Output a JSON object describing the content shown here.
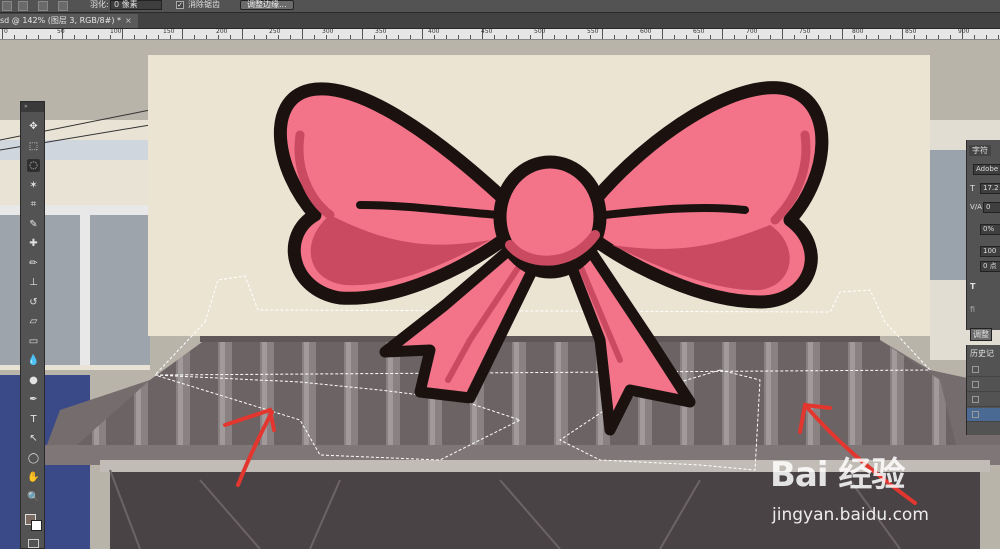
{
  "options_bar": {
    "feather_label": "羽化:",
    "feather_value": "0 像素",
    "antialias_label": "消除锯齿",
    "refine_edge_button": "调整边缘..."
  },
  "document_tab": {
    "title": "sd @ 142% (图层 3, RGB/8#) *",
    "close": "×"
  },
  "ruler": {
    "labels": [
      "0",
      "50",
      "100",
      "150",
      "200",
      "250",
      "300",
      "350",
      "400",
      "450",
      "500",
      "550",
      "600",
      "650",
      "700",
      "750",
      "800",
      "850",
      "900"
    ]
  },
  "tools": {
    "header": "»",
    "icons": [
      "move-icon",
      "marquee-icon",
      "lasso-icon",
      "magic-wand-icon",
      "crop-icon",
      "eyedropper-icon",
      "healing-brush-icon",
      "brush-icon",
      "clone-stamp-icon",
      "history-brush-icon",
      "eraser-icon",
      "gradient-icon",
      "blur-icon",
      "dodge-icon",
      "pen-icon",
      "type-icon",
      "path-select-icon",
      "shape-icon",
      "hand-icon",
      "zoom-icon"
    ],
    "glyphs": [
      "✥",
      "⬚",
      "◌",
      "✶",
      "⌗",
      "✎",
      "✚",
      "✏",
      "⊥",
      "↺",
      "▱",
      "▭",
      "💧",
      "●",
      "✒",
      "T",
      "↖",
      "◯",
      "✋",
      "🔍"
    ]
  },
  "character_panel": {
    "tab_label": "字符",
    "font": "Adobe",
    "size": "17.2",
    "tracking_label": "V/A",
    "tracking": "0",
    "percent": "0%",
    "scale": "100",
    "baseline": "0 点",
    "type_label": "T",
    "alt_label": "fi",
    "adjust_label": "调整"
  },
  "history_panel": {
    "title": "历史记"
  },
  "watermark": {
    "brand": "Bai 经验",
    "url": "jingyan.baidu.com"
  },
  "colors": {
    "canvas_bg": "#ece4d3",
    "bow_fill": "#f37489",
    "bow_shadow": "#c94a61",
    "bow_outline": "#1b1210",
    "roof": "#6f6667",
    "arrow": "#e2362e"
  }
}
